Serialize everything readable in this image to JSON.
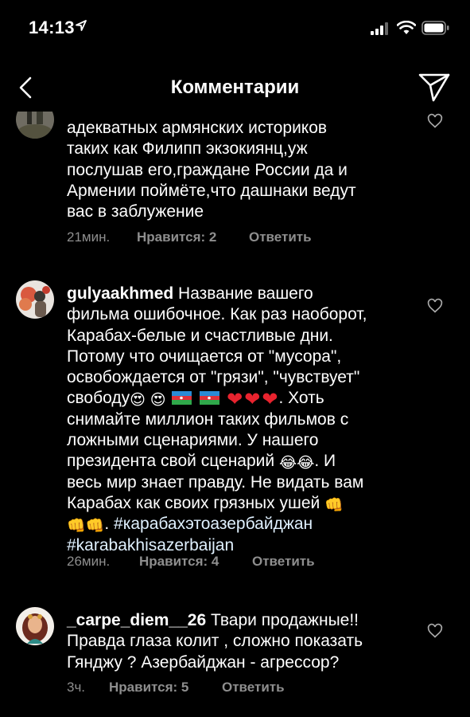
{
  "status_bar": {
    "time": "14:13",
    "icons": [
      "location-arrow-icon",
      "cellular-signal-icon",
      "wifi-icon",
      "battery-icon"
    ]
  },
  "nav": {
    "title": "Комментарии",
    "back_icon": "chevron-left-icon",
    "share_icon": "paper-plane-icon"
  },
  "comments": [
    {
      "username": "",
      "text_lines": [
        "адекватных армянских историков",
        "таких как Филипп экзокиянц,уж",
        "послушав его,граждане России да и",
        "Армении поймёте,что дашнаки ведут",
        "вас в заблужение"
      ],
      "time": "21мин.",
      "likes": "Нравится: 2",
      "reply": "Ответить"
    },
    {
      "username": "gulyaakhmed",
      "line1_rest": " Название вашего",
      "lines_a": [
        "фильма ошибочное. Как раз наоборот,",
        "Карабах-белые и счастливые дни.",
        "Потому что очищается от \"мусора\",",
        "освобождается от \"грязи\", \"чувствует\""
      ],
      "freedom_word": "свободу",
      "freedom_tail": ". Хоть",
      "lines_b": [
        "снимайте миллион таких фильмов с",
        "ложными сценариями. У нашего"
      ],
      "president_line": "президента свой сценарий",
      "president_tail": ". И",
      "lines_c": [
        "весь мир знает правду. Не видать вам"
      ],
      "ears_line": "Карабах как своих грязных ушей",
      "hashtag1": "#карабахэтоазербайджан",
      "hashtag2": "#karabakhisazerbaijan",
      "time": "26мин.",
      "likes": "Нравится: 4",
      "reply": "Ответить"
    },
    {
      "username": "_carpe_diem__26",
      "line1_rest": " Твари продажные!!",
      "lines": [
        "Правда глаза колит , сложно показать",
        "Гянджу ? Азербайджан - агрессор?"
      ],
      "time": "3ч.",
      "likes": "Нравится: 5",
      "reply": "Ответить"
    }
  ],
  "emojis": {
    "heart_eyes": "😍",
    "tears_of_joy": "😂",
    "fist": "👊",
    "heart": "❤"
  },
  "colors": {
    "background": "#000000",
    "text": "#ffffff",
    "meta": "#8e8e8e",
    "heart": "#e8232e"
  }
}
